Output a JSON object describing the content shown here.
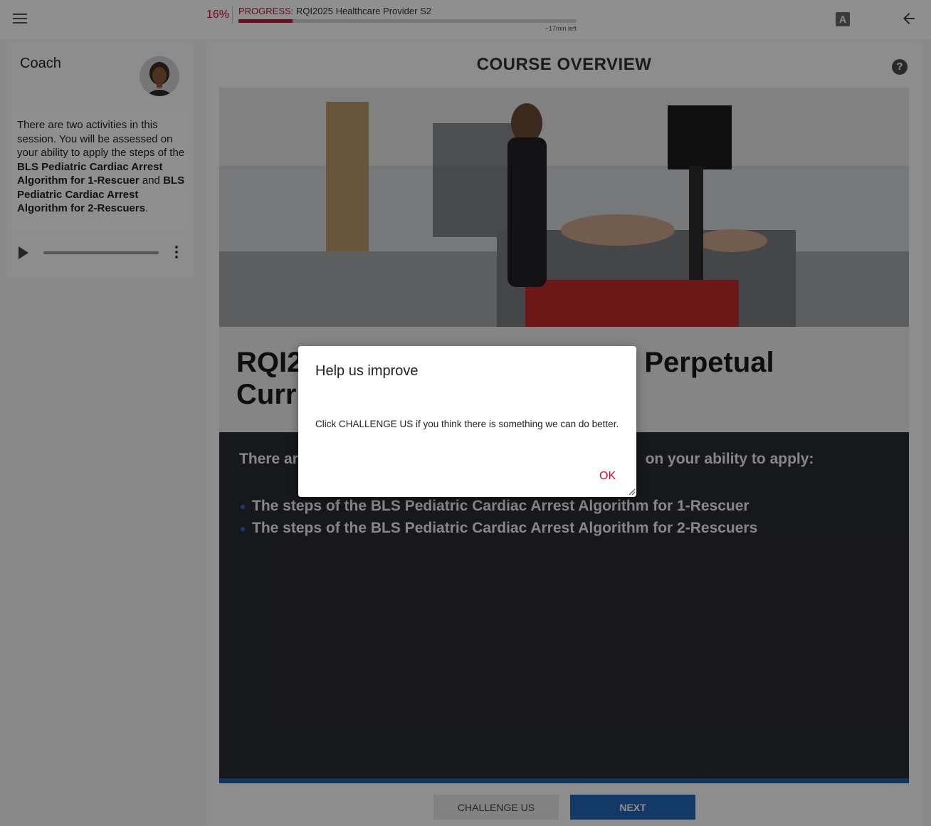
{
  "topbar": {
    "progress_percent": "16%",
    "progress_key": "PROGRESS:",
    "progress_course": "RQI2025 Healthcare Provider S2",
    "progress_fraction": 0.16,
    "time_left": "~17min left",
    "font_icon_label": "A"
  },
  "coach": {
    "title": "Coach",
    "message": {
      "part1": "There are two activities in this session.  You will be assessed on your ability to apply the steps of the ",
      "bold1": "BLS Pediatric Cardiac Arrest Algorithm for 1-Rescuer",
      "part2": " and ",
      "bold2": "BLS Pediatric Cardiac Arrest Algorithm for 2-Rescuers",
      "part3": "."
    },
    "audio_progress": 0
  },
  "main": {
    "title": "COURSE OVERVIEW",
    "help_label": "?",
    "course_name_line1_left": "RQI2",
    "course_name_line1_right": "Perpetual",
    "course_name_line2": "Curri",
    "lead_left": "There are",
    "lead_right": "on your ability to apply:",
    "bullets": [
      "The steps of the BLS Pediatric Cardiac Arrest Algorithm for 1-Rescuer",
      "The steps of the BLS Pediatric Cardiac Arrest Algorithm for 2-Rescuers"
    ],
    "challenge_label": "CHALLENGE US",
    "next_label": "NEXT"
  },
  "modal": {
    "title": "Help us improve",
    "body": "Click CHALLENGE US if you think there is something we can do better.",
    "ok_label": "OK"
  },
  "colors": {
    "brand_red": "#c8102e",
    "brand_blue": "#2066b8",
    "dark_panel": "#2a2b31"
  }
}
